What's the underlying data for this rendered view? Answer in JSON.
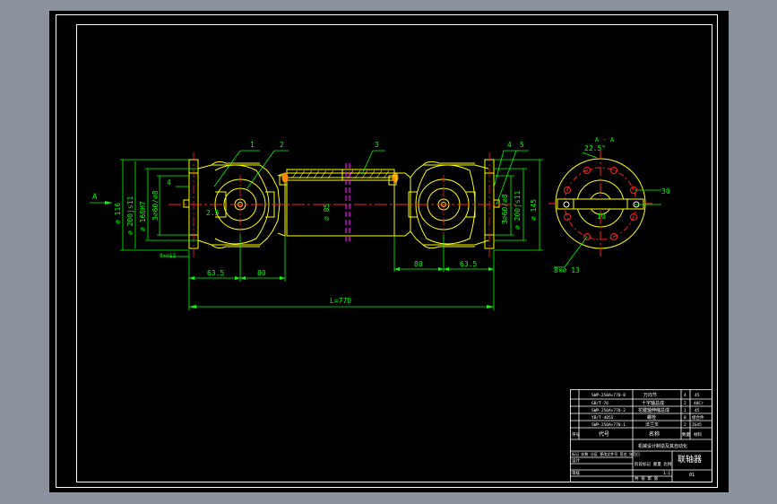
{
  "colors": {
    "background": "#000000",
    "frame": "#ffffff",
    "outline": "#ffff00",
    "dimension": "#00ff00",
    "centerline": "#ff2222",
    "section_mark": "#ff00ff",
    "hatch": "#ffff00",
    "viewport": "#8b929e"
  },
  "drawing": {
    "view_label": "A",
    "section_label": "A - A",
    "part_numbers": [
      "1",
      "2",
      "3",
      "4",
      "5"
    ],
    "dims": {
      "d116": "⌀ 116",
      "d200": "⌀ 200js11",
      "d160": "⌀ 160H7",
      "d60": "3⌀60/⌀8",
      "four": "4",
      "half": "2.5",
      "holes_left": "8×⌀13",
      "d85": "⌀ 85",
      "d200r": "⌀ 200js11",
      "d145": "⌀ 145",
      "d60r": "3⌀60/⌀8",
      "l635": "63.5",
      "l80a": "80",
      "l80b": "80",
      "l635b": "63.5",
      "total": "L=770",
      "ang": "22.5°",
      "r30": "30",
      "r10": "10",
      "holes_right": "8×⌀ 13"
    }
  },
  "title_block": {
    "parts_rows": [
      {
        "code": "SWP-250A×770-8",
        "name": "万向节",
        "qty": "4",
        "mat": "45"
      },
      {
        "code": "GB/T-76",
        "name": "十字轴总成",
        "qty": "2",
        "mat": "40Cr"
      },
      {
        "code": "SWP-250A×770-2",
        "name": "花键轴伸缩总成",
        "qty": "1",
        "mat": "45"
      },
      {
        "code": "YB/T-4055",
        "name": "螺栓",
        "qty": "8",
        "mat": "组合件"
      },
      {
        "code": "SWP-250A×770-1",
        "name": "法兰叉",
        "qty": "2",
        "mat": "ZG45"
      }
    ],
    "header": {
      "no": "序号",
      "code": "代号",
      "name": "名称",
      "qty": "数量",
      "mat": "材料"
    },
    "school": "机械设计制造及其自动化",
    "title": "联轴器",
    "scale": "1:1",
    "sign_row": [
      "标记",
      "处数",
      "分区",
      "更改文件号",
      "签名",
      "年月日"
    ],
    "meta_labels": [
      "设计",
      "审核",
      "工艺",
      "批准"
    ],
    "stage_labels": [
      "阶段标记",
      "重量",
      "比例"
    ],
    "sheet": "共 张  第 张",
    "drawing_no": "01"
  }
}
